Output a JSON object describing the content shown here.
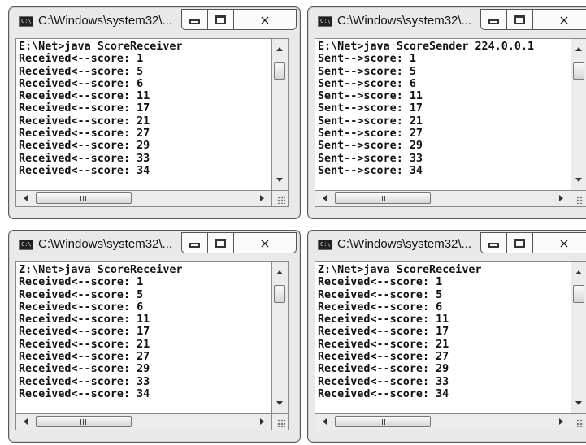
{
  "windows": [
    {
      "title": "C:\\Windows\\system32\\...",
      "close_glyph": "⨯",
      "lines": [
        "E:\\Net>java ScoreReceiver",
        "Received<--score: 1",
        "Received<--score: 5",
        "Received<--score: 6",
        "Received<--score: 11",
        "Received<--score: 17",
        "Received<--score: 21",
        "Received<--score: 27",
        "Received<--score: 29",
        "Received<--score: 33",
        "Received<--score: 34"
      ]
    },
    {
      "title": "C:\\Windows\\system32\\...",
      "close_glyph": "⨯",
      "lines": [
        "E:\\Net>java ScoreSender 224.0.0.1",
        "Sent-->score: 1",
        "Sent-->score: 5",
        "Sent-->score: 6",
        "Sent-->score: 11",
        "Sent-->score: 17",
        "Sent-->score: 21",
        "Sent-->score: 27",
        "Sent-->score: 29",
        "Sent-->score: 33",
        "Sent-->score: 34"
      ]
    },
    {
      "title": "C:\\Windows\\system32\\...",
      "close_glyph": "⨯",
      "lines": [
        "Z:\\Net>java ScoreReceiver",
        "Received<--score: 1",
        "Received<--score: 5",
        "Received<--score: 6",
        "Received<--score: 11",
        "Received<--score: 17",
        "Received<--score: 21",
        "Received<--score: 27",
        "Received<--score: 29",
        "Received<--score: 33",
        "Received<--score: 34"
      ]
    },
    {
      "title": "C:\\Windows\\system32\\...",
      "close_glyph": "⨯",
      "lines": [
        "Z:\\Net>java ScoreReceiver",
        "Received<--score: 1",
        "Received<--score: 5",
        "Received<--score: 6",
        "Received<--score: 11",
        "Received<--score: 17",
        "Received<--score: 21",
        "Received<--score: 27",
        "Received<--score: 29",
        "Received<--score: 33",
        "Received<--score: 34"
      ]
    }
  ],
  "app_icon_glyph": "C:\\",
  "scroll_thumb_glyph": "III",
  "icons": {
    "app": "console-icon",
    "minimize": "minimize-icon",
    "maximize": "maximize-icon",
    "close": "close-icon"
  },
  "colors": {
    "console_bg": "#ffffff",
    "console_text": "#111111",
    "chrome": "#e9e9e9",
    "border": "#5a5a5a"
  }
}
